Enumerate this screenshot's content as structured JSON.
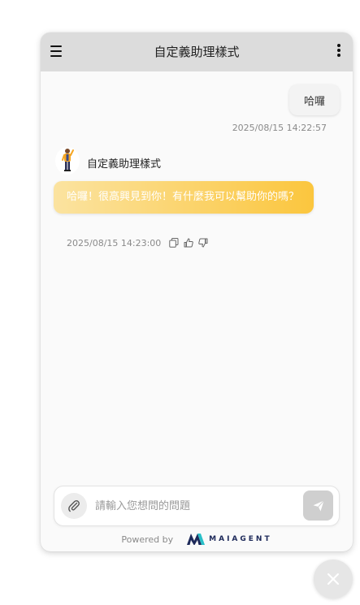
{
  "header": {
    "title": "自定義助理樣式"
  },
  "messages": {
    "user": {
      "text": "哈囉",
      "time": "2025/08/15 14:22:57"
    },
    "bot": {
      "name": "自定義助理樣式",
      "text": "哈囉！很高興見到你！有什麼我可以幫助你的嗎？",
      "time": "2025/08/15 14:23:00"
    }
  },
  "input": {
    "placeholder": "請輸入您想問的問題"
  },
  "footer": {
    "powered_by": "Powered by",
    "brand_name": "MAIAGENT"
  },
  "colors": {
    "bot_bubble_start": "#fbe3a0",
    "bot_bubble_end": "#fbc63e",
    "brand_blue": "#1e2a5a",
    "brand_teal": "#29c0c8"
  },
  "icons": {
    "menu": "menu-icon",
    "more": "more-vertical-icon",
    "copy": "copy-icon",
    "like": "thumbs-up-icon",
    "dislike": "thumbs-down-icon",
    "attach": "paperclip-icon",
    "send": "send-icon",
    "close": "close-icon"
  }
}
